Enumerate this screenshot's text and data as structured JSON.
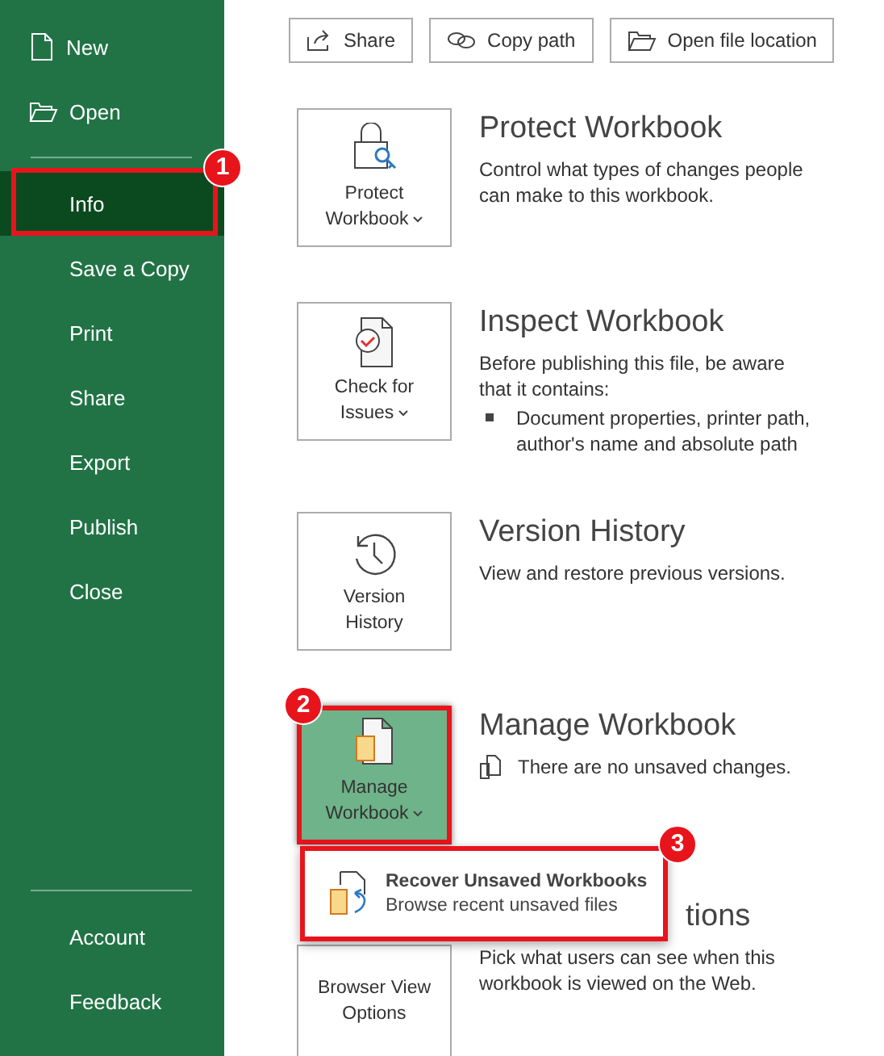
{
  "sidebar": {
    "top_items": [
      {
        "label": "New",
        "selected": false
      },
      {
        "label": "Open",
        "selected": false
      }
    ],
    "items": [
      {
        "label": "Info",
        "selected": true,
        "callout": "1"
      },
      {
        "label": "Save a Copy",
        "selected": false
      },
      {
        "label": "Print",
        "selected": false
      },
      {
        "label": "Share",
        "selected": false
      },
      {
        "label": "Export",
        "selected": false
      },
      {
        "label": "Publish",
        "selected": false
      },
      {
        "label": "Close",
        "selected": false
      }
    ],
    "bottom_items": [
      {
        "label": "Account",
        "selected": false
      },
      {
        "label": "Feedback",
        "selected": false
      }
    ]
  },
  "toolbar": [
    {
      "label": "Share"
    },
    {
      "label": "Copy path"
    },
    {
      "label": "Open file location"
    }
  ],
  "sections": [
    {
      "button": [
        "Protect",
        "Workbook"
      ],
      "dropdown": true,
      "highlighted": false,
      "title": "Protect Workbook",
      "description": "Control what types of changes people can make to this workbook."
    },
    {
      "button": [
        "Check for",
        "Issues"
      ],
      "dropdown": true,
      "highlighted": false,
      "title": "Inspect Workbook",
      "description": "Before publishing this file, be aware that it contains:",
      "bullets": [
        "Document properties, printer path, author's name and absolute path"
      ]
    },
    {
      "button": [
        "Version",
        "History"
      ],
      "dropdown": false,
      "highlighted": false,
      "title": "Version History",
      "description": "View and restore previous versions."
    },
    {
      "button": [
        "Manage",
        "Workbook"
      ],
      "dropdown": true,
      "highlighted": true,
      "callout": "2",
      "title": "Manage Workbook",
      "status": "There are no unsaved changes.",
      "popup": {
        "title": "Recover Unsaved Workbooks",
        "subtitle": "Browse recent unsaved files",
        "callout": "3"
      }
    },
    {
      "button": [
        "Browser View",
        "Options"
      ],
      "dropdown": false,
      "highlighted": false,
      "title": "tions",
      "description": "Pick what users can see when this workbook is viewed on the Web."
    }
  ]
}
